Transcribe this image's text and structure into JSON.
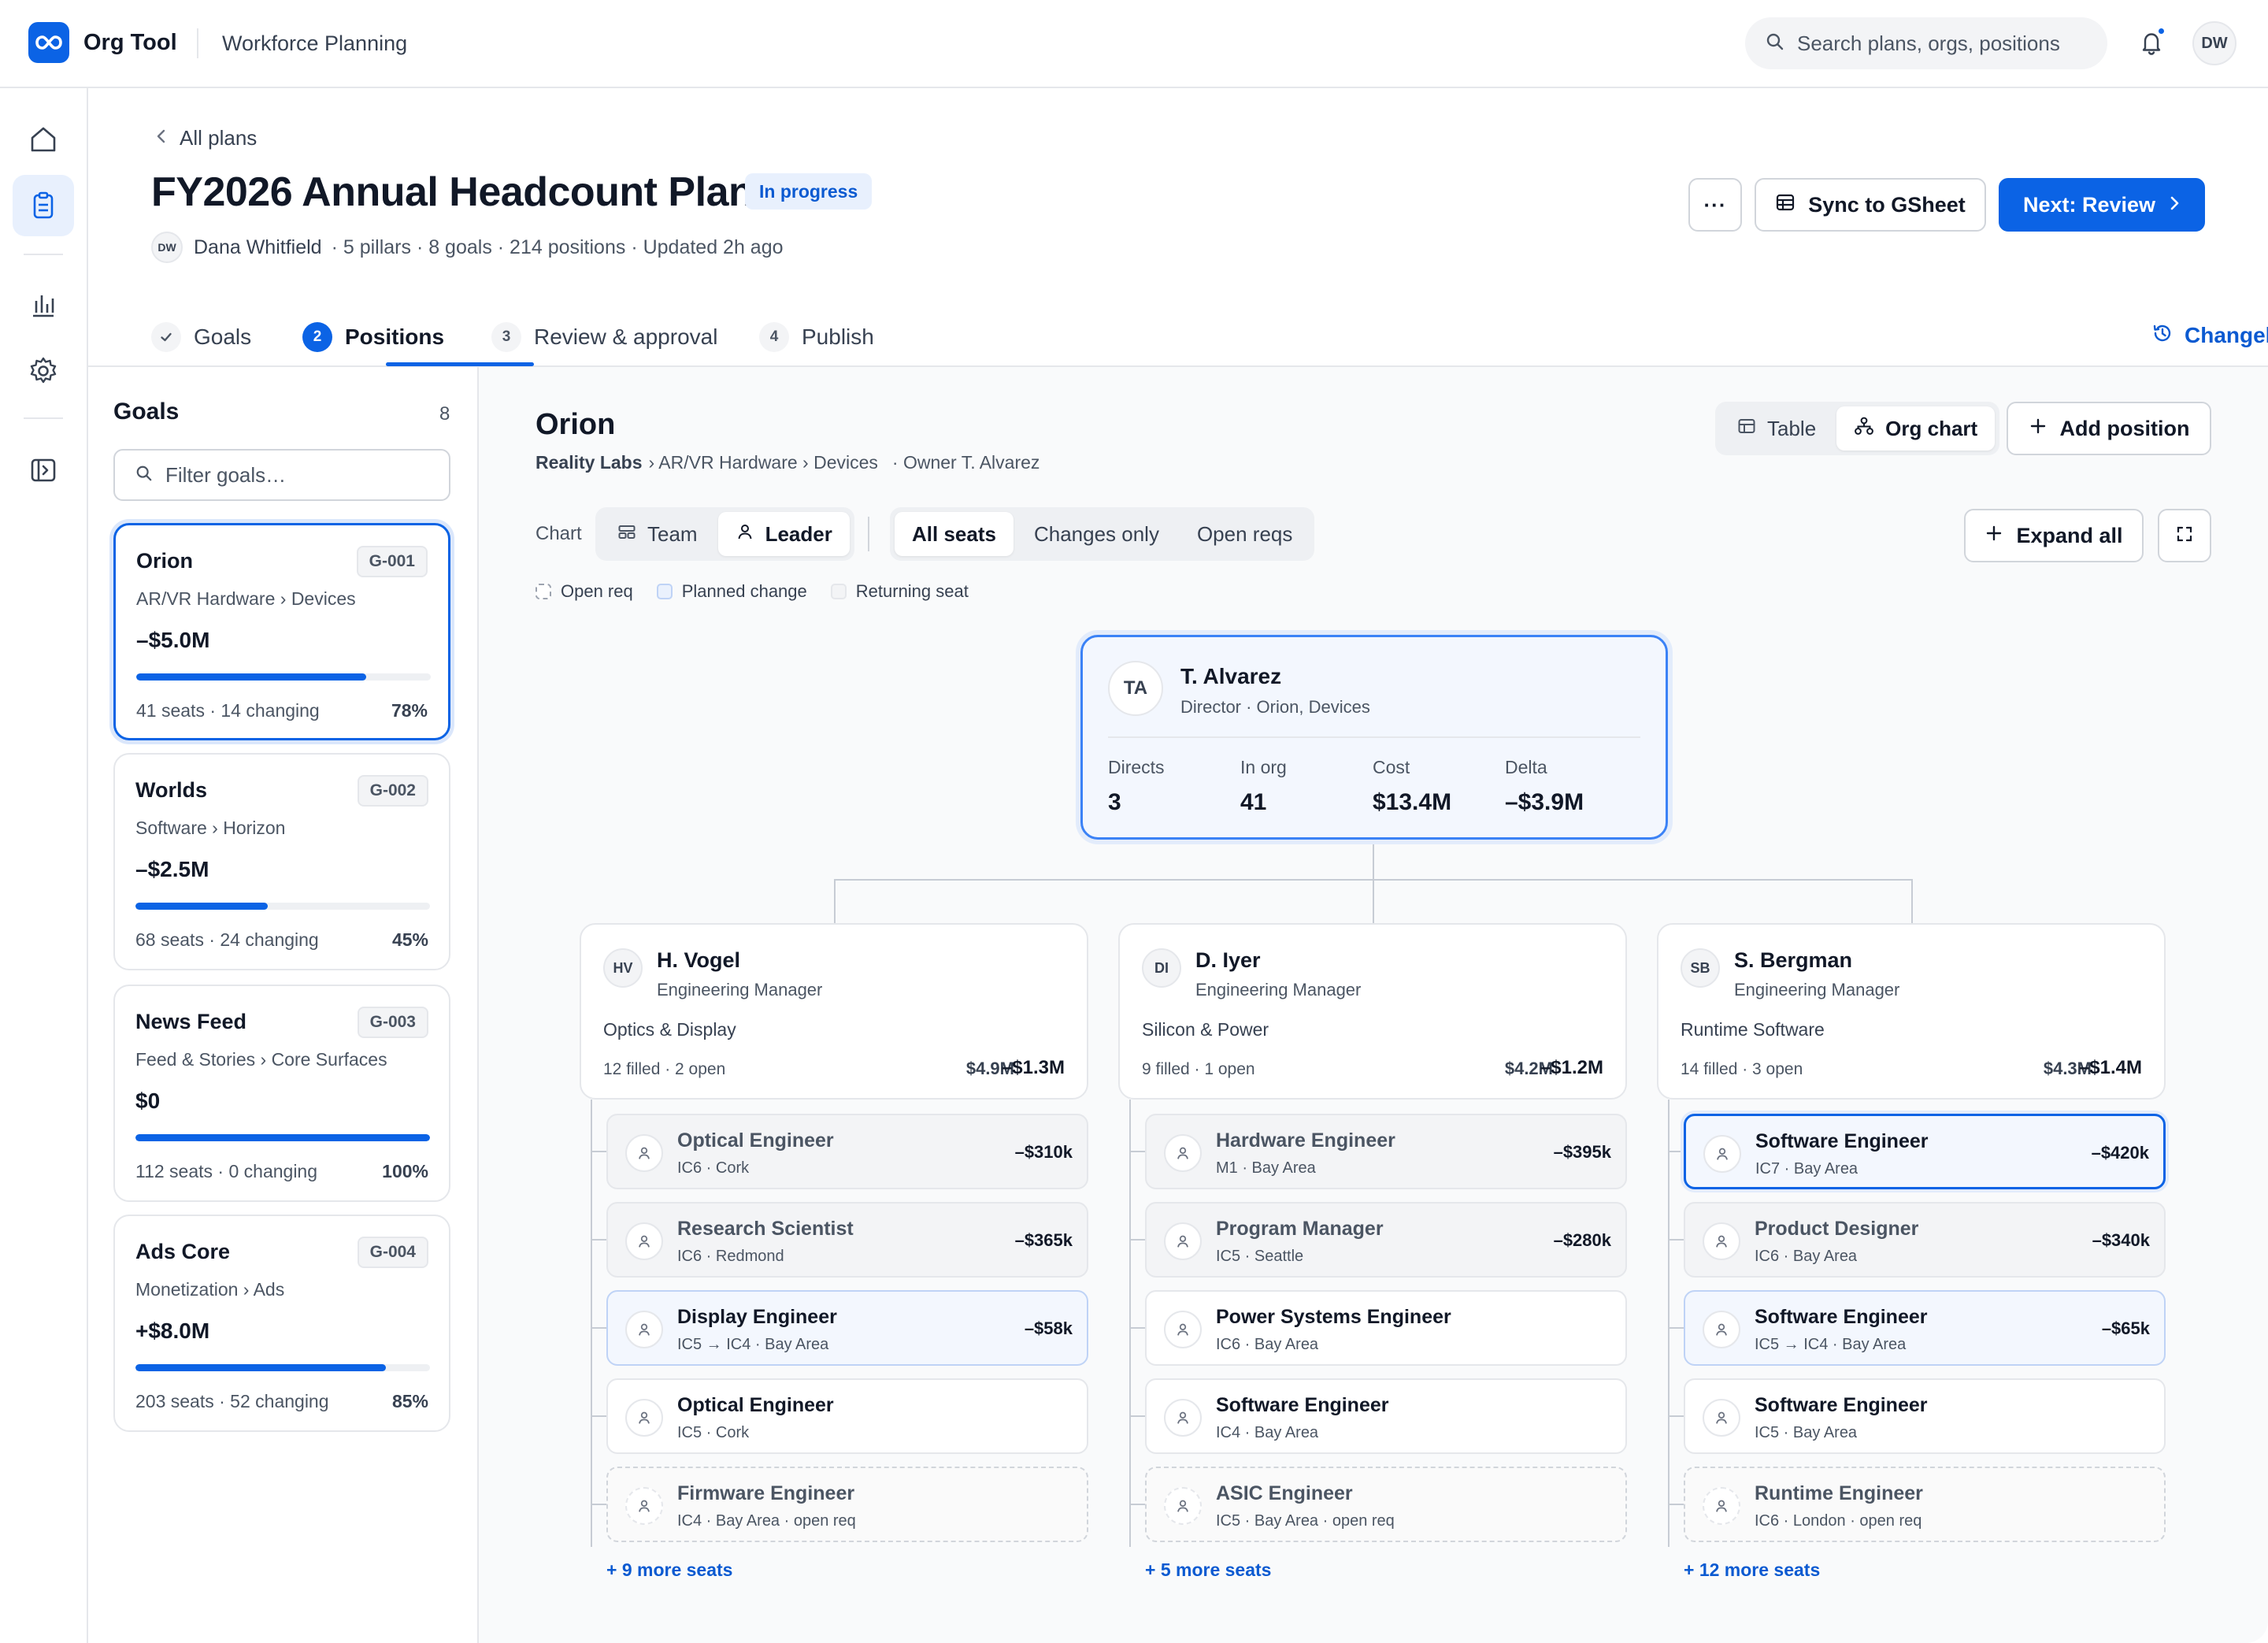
{
  "app": {
    "brand": "Org Tool",
    "section": "Workforce Planning",
    "user_initials": "DW"
  },
  "search": {
    "placeholder": "Search plans, orgs, positions"
  },
  "header": {
    "back_label": "All plans",
    "title": "FY2026 Annual Headcount Plan",
    "status": "In progress",
    "owner_initials": "DW",
    "owner": "Dana Whitfield",
    "meta": "· 5 pillars · 8 goals · 214 positions · Updated 2h ago",
    "more_label": "···",
    "sync_label": "Sync to GSheet",
    "next_label": "Next: Review"
  },
  "tabs": [
    {
      "num": "✓",
      "label": "Goals"
    },
    {
      "num": "2",
      "label": "Positions"
    },
    {
      "num": "3",
      "label": "Review & approval"
    },
    {
      "num": "4",
      "label": "Publish"
    }
  ],
  "changelog_label": "Changelog",
  "goals": {
    "title": "Goals",
    "count": "8",
    "filter_placeholder": "Filter goals…",
    "items": [
      {
        "name": "Orion",
        "id": "G-001",
        "path": "AR/VR Hardware › Devices",
        "amount": "–$5.0M",
        "progress": 0.78,
        "foot": "41 seats · 14 changing",
        "pct": "78%"
      },
      {
        "name": "Worlds",
        "id": "G-002",
        "path": "Software › Horizon",
        "amount": "–$2.5M",
        "progress": 0.45,
        "foot": "68 seats · 24 changing",
        "pct": "45%"
      },
      {
        "name": "News Feed",
        "id": "G-003",
        "path": "Feed & Stories › Core Surfaces",
        "amount": "$0",
        "progress": 1.0,
        "foot": "112 seats · 0 changing",
        "pct": "100%"
      },
      {
        "name": "Ads Core",
        "id": "G-004",
        "path": "Monetization › Ads",
        "amount": "+$8.0M",
        "progress": 0.85,
        "foot": "203 seats · 52 changing",
        "pct": "85%"
      }
    ]
  },
  "main": {
    "title": "Orion",
    "path_root": "Reality Labs",
    "path_rest": "› AR/VR Hardware › Devices",
    "owner": "· Owner T. Alvarez",
    "view_table": "Table",
    "view_org": "Org chart",
    "add_position": "Add position",
    "chart_label": "Chart",
    "chart_team": "Team",
    "chart_leader": "Leader",
    "filter_all": "All seats",
    "filter_changes": "Changes only",
    "filter_open": "Open reqs",
    "expand_all": "Expand all",
    "legend": {
      "open_req": "Open req",
      "planned": "Planned change",
      "returning": "Returning seat"
    }
  },
  "leader": {
    "initials": "TA",
    "name": "T. Alvarez",
    "role": "Director · Orion, Devices",
    "stats": [
      {
        "k": "Directs",
        "v": "3"
      },
      {
        "k": "In org",
        "v": "41"
      },
      {
        "k": "Cost",
        "v": "$13.4M"
      },
      {
        "k": "Delta",
        "v": "–$3.9M"
      }
    ]
  },
  "managers": [
    {
      "initials": "HV",
      "name": "H. Vogel",
      "role": "Engineering Manager",
      "team": "Optics & Display",
      "foot": "12 filled · 2 open",
      "cost": "$4.9M",
      "delta": "–$1.3M",
      "more": "+ 9 more seats",
      "seats": [
        {
          "title": "Optical Engineer",
          "sub": "IC6 · Cork",
          "delta": "–$310k",
          "state": "greyed"
        },
        {
          "title": "Research Scientist",
          "sub": "IC6 · Redmond",
          "delta": "–$365k",
          "state": "greyed"
        },
        {
          "title": "Display Engineer",
          "sub": "IC5 → IC4 · Bay Area",
          "delta": "–$58k",
          "state": "changed"
        },
        {
          "title": "Optical Engineer",
          "sub": "IC5 · Cork",
          "delta": "",
          "state": "normal"
        },
        {
          "title": "Firmware Engineer",
          "sub": "IC4 · Bay Area · open req",
          "delta": "",
          "state": "open"
        }
      ]
    },
    {
      "initials": "DI",
      "name": "D. Iyer",
      "role": "Engineering Manager",
      "team": "Silicon & Power",
      "foot": "9 filled · 1 open",
      "cost": "$4.2M",
      "delta": "–$1.2M",
      "more": "+ 5 more seats",
      "seats": [
        {
          "title": "Hardware Engineer",
          "sub": "M1 · Bay Area",
          "delta": "–$395k",
          "state": "greyed"
        },
        {
          "title": "Program Manager",
          "sub": "IC5 · Seattle",
          "delta": "–$280k",
          "state": "greyed"
        },
        {
          "title": "Power Systems Engineer",
          "sub": "IC6 · Bay Area",
          "delta": "",
          "state": "normal"
        },
        {
          "title": "Software Engineer",
          "sub": "IC4 · Bay Area",
          "delta": "",
          "state": "normal"
        },
        {
          "title": "ASIC Engineer",
          "sub": "IC5 · Bay Area · open req",
          "delta": "",
          "state": "open"
        }
      ]
    },
    {
      "initials": "SB",
      "name": "S. Bergman",
      "role": "Engineering Manager",
      "team": "Runtime Software",
      "foot": "14 filled · 3 open",
      "cost": "$4.3M",
      "delta": "–$1.4M",
      "more": "+ 12 more seats",
      "seats": [
        {
          "title": "Software Engineer",
          "sub": "IC7 · Bay Area",
          "delta": "–$420k",
          "state": "selected"
        },
        {
          "title": "Product Designer",
          "sub": "IC6 · Bay Area",
          "delta": "–$340k",
          "state": "greyed"
        },
        {
          "title": "Software Engineer",
          "sub": "IC5 → IC4 · Bay Area",
          "delta": "–$65k",
          "state": "changed"
        },
        {
          "title": "Software Engineer",
          "sub": "IC5 · Bay Area",
          "delta": "",
          "state": "normal"
        },
        {
          "title": "Runtime Engineer",
          "sub": "IC6 · London · open req",
          "delta": "",
          "state": "open"
        }
      ]
    }
  ],
  "colors": {
    "accent": "#0b63e5",
    "accent_soft": "#e8f0fd",
    "border": "#e5e7eb",
    "muted": "#4b5563"
  }
}
